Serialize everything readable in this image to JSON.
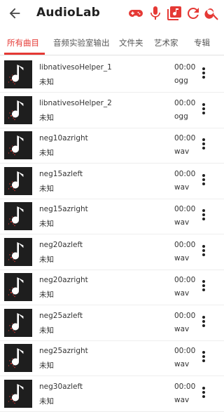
{
  "app": {
    "title": "AudioLab"
  },
  "icons": {
    "back": "arrow-back-icon",
    "toolbar": [
      "gamepad-icon",
      "microphone-icon",
      "music-library-icon",
      "refresh-icon",
      "search-icon"
    ],
    "thumb": "music-note-icon",
    "more": "more-vertical-icon"
  },
  "colors": {
    "accent": "#e53935"
  },
  "tabs": [
    {
      "label": "所有曲目",
      "active": true
    },
    {
      "label": "音频实验室输出",
      "active": false
    },
    {
      "label": "文件夹",
      "active": false
    },
    {
      "label": "艺术家",
      "active": false
    },
    {
      "label": "专辑",
      "active": false
    }
  ],
  "tracks": [
    {
      "name": "libnativesoHelper_1",
      "artist": "未知",
      "duration": "00:00",
      "format": "ogg"
    },
    {
      "name": "libnativesoHelper_2",
      "artist": "未知",
      "duration": "00:00",
      "format": "ogg"
    },
    {
      "name": "neg10azright",
      "artist": "未知",
      "duration": "00:00",
      "format": "wav"
    },
    {
      "name": "neg15azleft",
      "artist": "未知",
      "duration": "00:00",
      "format": "wav"
    },
    {
      "name": "neg15azright",
      "artist": "未知",
      "duration": "00:00",
      "format": "wav"
    },
    {
      "name": "neg20azleft",
      "artist": "未知",
      "duration": "00:00",
      "format": "wav"
    },
    {
      "name": "neg20azright",
      "artist": "未知",
      "duration": "00:00",
      "format": "wav"
    },
    {
      "name": "neg25azleft",
      "artist": "未知",
      "duration": "00:00",
      "format": "wav"
    },
    {
      "name": "neg25azright",
      "artist": "未知",
      "duration": "00:00",
      "format": "wav"
    },
    {
      "name": "neg30azleft",
      "artist": "未知",
      "duration": "00:00",
      "format": "wav"
    }
  ]
}
